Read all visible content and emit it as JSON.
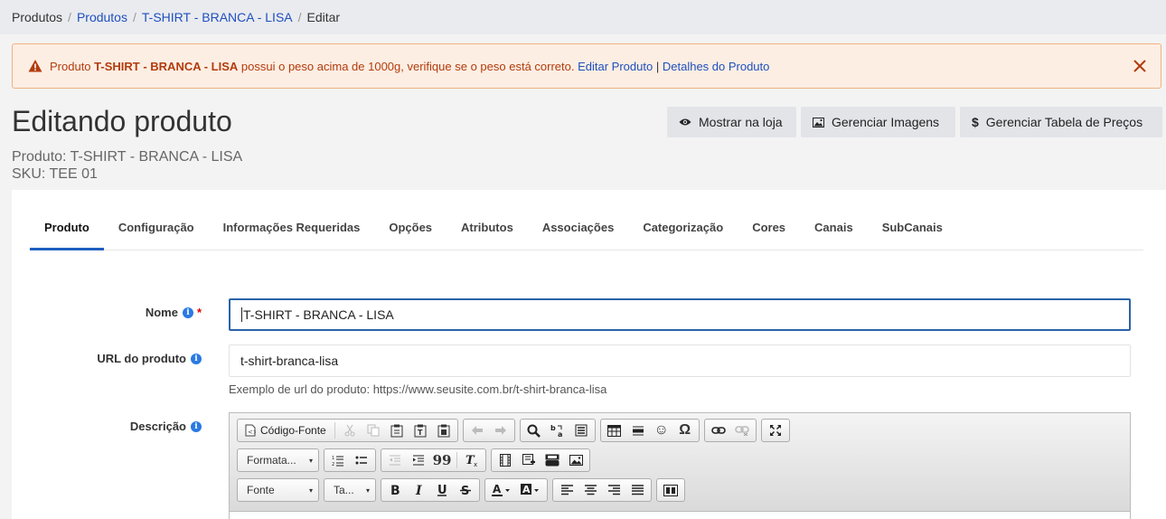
{
  "breadcrumb": {
    "items": [
      "Produtos",
      "Produtos",
      "T-SHIRT - BRANCA - LISA",
      "Editar"
    ],
    "separator": "/"
  },
  "alert": {
    "prefix": "Produto",
    "product": "T-SHIRT - BRANCA - LISA",
    "message": "possui o peso acima de 1000g, verifique se o peso está correto.",
    "edit_link": "Editar Produto",
    "pipe": "|",
    "details_link": "Detalhes do Produto",
    "icon": "warning-icon",
    "color": "#b23c0d"
  },
  "page": {
    "title": "Editando produto",
    "product_line": "Produto: T-SHIRT - BRANCA - LISA",
    "sku_line": "SKU: TEE 01"
  },
  "toolbar": {
    "show_store": "Mostrar na loja",
    "manage_images": "Gerenciar Imagens",
    "manage_prices": "Gerenciar Tabela de Preços"
  },
  "tabs": [
    "Produto",
    "Configuração",
    "Informações Requeridas",
    "Opções",
    "Atributos",
    "Associações",
    "Categorização",
    "Cores",
    "Canais",
    "SubCanais"
  ],
  "form": {
    "name_label": "Nome",
    "name_value": "T-SHIRT - BRANCA - LISA",
    "required_mark": "*",
    "url_label": "URL do produto",
    "url_value": "t-shirt-branca-lisa",
    "url_help": "Exemplo de url do produto: https://www.seusite.com.br/t-shirt-branca-lisa",
    "desc_label": "Descrição",
    "info_glyph": "i"
  },
  "editor": {
    "source": "Código-Fonte",
    "format": "Formata...",
    "font": "Fonte",
    "size": "Ta...",
    "car": "▾",
    "quote": "99",
    "omega": "Ω",
    "smiley": "☺"
  },
  "colors": {
    "accent": "#1f5fbf",
    "link": "#1f4fbf",
    "alert_bg": "#fdeee3",
    "alert_border": "#f3b080"
  }
}
